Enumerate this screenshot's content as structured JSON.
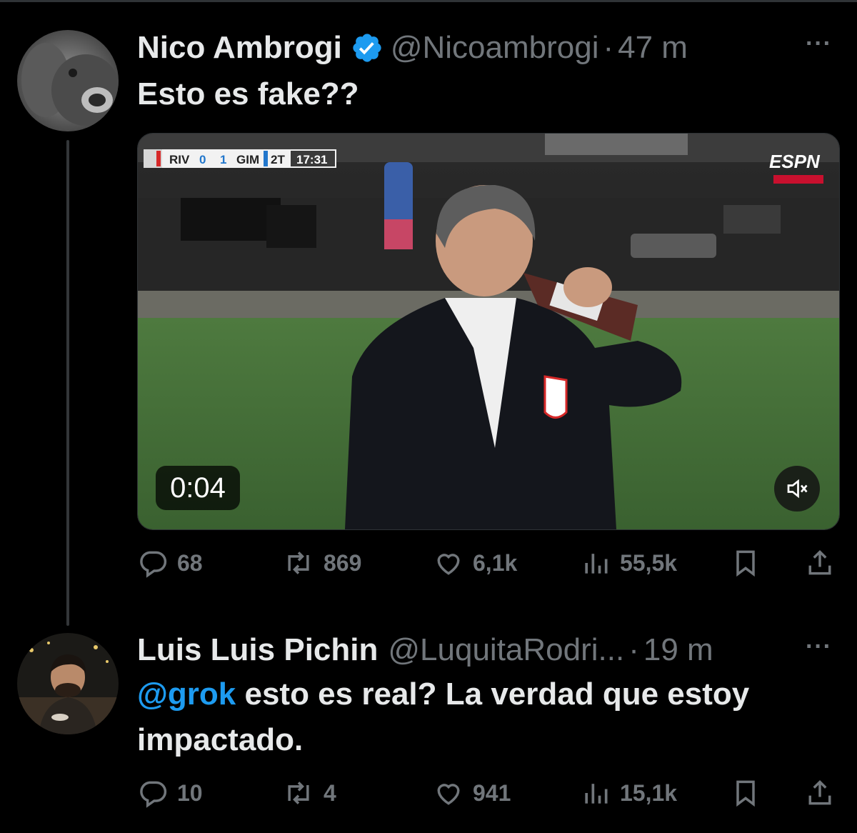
{
  "colors": {
    "background": "#000000",
    "text": "#e7e9ea",
    "muted": "#71767b",
    "accent": "#1d9bf0",
    "thread_line": "#333639"
  },
  "tweets": [
    {
      "author_name": "Nico Ambrogi",
      "verified": true,
      "handle": "@Nicoambrogi",
      "separator": "·",
      "time": "47 m",
      "text": "Esto es fake??",
      "media": {
        "type": "video",
        "duration": "0:04",
        "scorebug": {
          "home": "RIV",
          "home_score": "0",
          "away_score": "1",
          "away": "GIM",
          "period": "2T",
          "clock": "17:31"
        },
        "broadcaster": "ESPN"
      },
      "stats": {
        "replies": "68",
        "reposts": "869",
        "likes": "6,1k",
        "views": "55,5k"
      }
    },
    {
      "author_name": "Luis Luis Pichin",
      "verified": false,
      "handle": "@LuquitaRodri...",
      "separator": "·",
      "time": "19 m",
      "mention": "@grok",
      "text_line1": " esto es real? La verdad que estoy",
      "text_line2": "impactado.",
      "stats": {
        "replies": "10",
        "reposts": "4",
        "likes": "941",
        "views": "15,1k"
      }
    }
  ],
  "icons": [
    "reply-icon",
    "repost-icon",
    "like-icon",
    "views-icon",
    "bookmark-icon",
    "share-icon",
    "more-icon",
    "mute-icon",
    "verified-icon"
  ]
}
